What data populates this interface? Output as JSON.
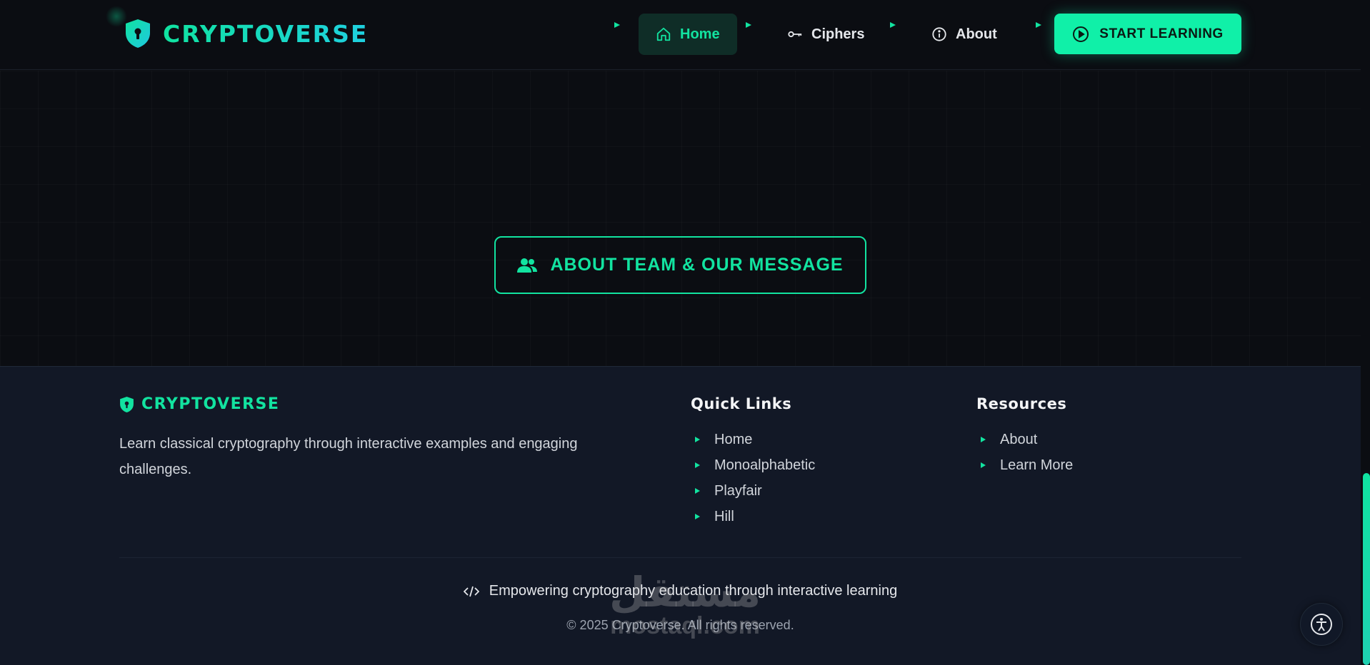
{
  "brand": {
    "name": "CRYPTOVERSE"
  },
  "nav": {
    "items": [
      {
        "label": "Home",
        "icon": "home-icon",
        "active": true
      },
      {
        "label": "Ciphers",
        "icon": "key-icon",
        "active": false
      },
      {
        "label": "About",
        "icon": "info-icon",
        "active": false
      }
    ],
    "cta_label": "START LEARNING",
    "cta_icon": "play-circle-icon"
  },
  "main": {
    "about_button_label": "ABOUT TEAM & OUR MESSAGE",
    "about_button_icon": "users-icon"
  },
  "footer": {
    "brand": "CRYPTOVERSE",
    "description": "Learn classical cryptography through interactive examples and engaging challenges.",
    "quick_links": {
      "title": "Quick Links",
      "items": [
        "Home",
        "Monoalphabetic",
        "Playfair",
        "Hill"
      ]
    },
    "resources": {
      "title": "Resources",
      "items": [
        "About",
        "Learn More"
      ]
    },
    "tagline": "Empowering cryptography education through interactive learning",
    "copyright": "© 2025 Cryptoverse. All rights reserved."
  },
  "watermark": {
    "arabic": "مستقل",
    "latin": "mostaql.com"
  },
  "colors": {
    "accent": "#10f0a8",
    "background": "#0b0d12",
    "footer_bg": "#121826"
  }
}
